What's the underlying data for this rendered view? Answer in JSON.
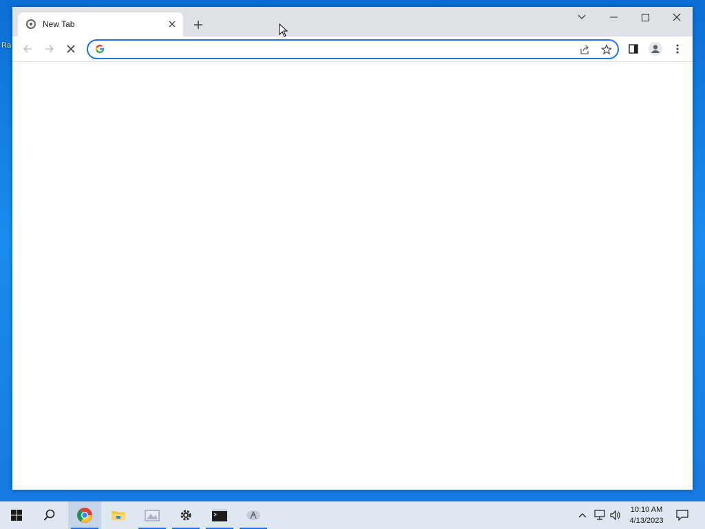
{
  "desktop": {
    "icon_label_fragment": "Ra"
  },
  "browser": {
    "tab": {
      "title": "New Tab"
    },
    "omnibox": {
      "value": "",
      "placeholder": ""
    }
  },
  "taskbar": {
    "clock": {
      "time": "10:10 AM",
      "date": "4/13/2023"
    },
    "apps": [
      "start-icon",
      "search-icon",
      "chrome-icon",
      "file-explorer-icon",
      "photos-icon",
      "settings-icon",
      "terminal-icon",
      "lambda-app-icon"
    ]
  },
  "colors": {
    "accent": "#1a73e8",
    "tabstrip": "#dee1e6",
    "taskbar": "#dfe7f1",
    "desktop": "#1a8cf0"
  }
}
